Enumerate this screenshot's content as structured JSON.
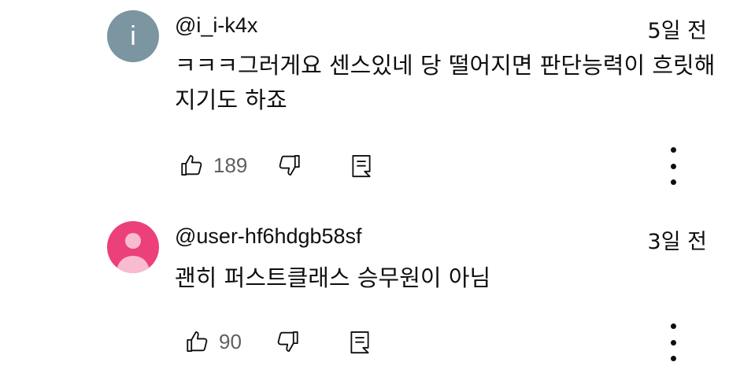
{
  "comments": [
    {
      "avatar_letter": "i",
      "avatar_color": "#7b95a1",
      "avatar_type": "letter",
      "handle": "@i_i-k4x",
      "time": "5일 전",
      "text": "ㅋㅋㅋ그러게요 센스있네 당 떨어지면 판단능력이 흐릿해지기도 하죠",
      "likes": "189"
    },
    {
      "avatar_color": "#ec407a",
      "avatar_type": "default-user-icon",
      "handle": "@user-hf6hdgb58sf",
      "time": "3일 전",
      "text": "괜히 퍼스트클래스 승무원이 아님",
      "likes": "90"
    }
  ],
  "icons": {
    "like": "thumbs-up-icon",
    "dislike": "thumbs-down-icon",
    "reply": "reply-icon",
    "menu": "more-vertical-icon"
  },
  "colors": {
    "text": "#0f0f0f",
    "secondary_text": "#606060"
  }
}
